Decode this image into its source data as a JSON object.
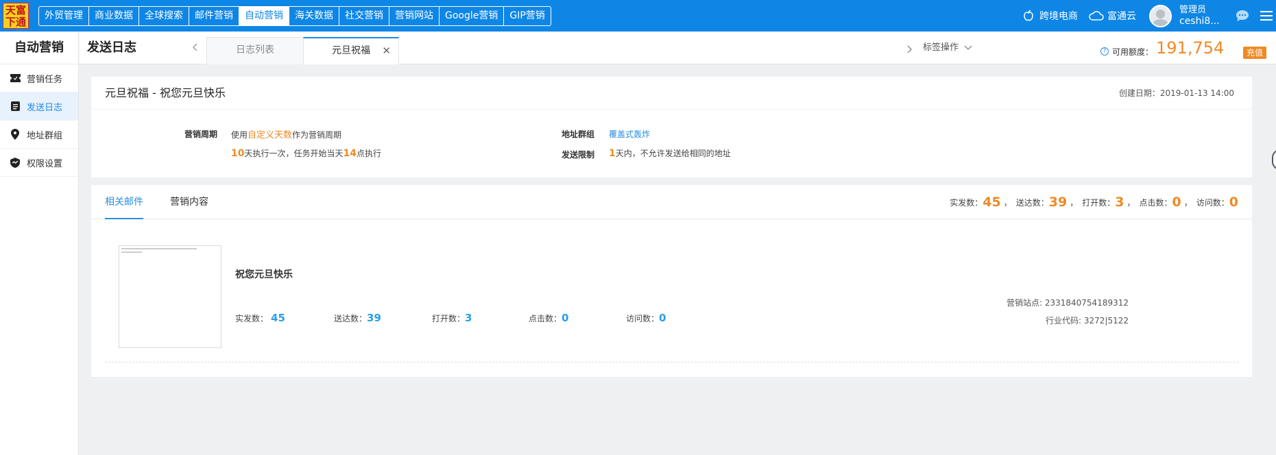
{
  "logo": {
    "text_line1": "天富",
    "text_line2": "下通"
  },
  "nav": {
    "items": [
      "外贸管理",
      "商业数据",
      "全球搜索",
      "邮件营销",
      "自动营销",
      "海关数据",
      "社交营销",
      "营销网站",
      "Google营销",
      "GIP营销"
    ],
    "active": "自动营销"
  },
  "topright": {
    "cross_border": "跨境电商",
    "cloud": "富通云",
    "user_role": "管理员",
    "user_name": "ceshi8..."
  },
  "sidebar": {
    "title": "自动营销",
    "items": [
      {
        "label": "营销任务",
        "icon": "ticket-icon"
      },
      {
        "label": "发送日志",
        "icon": "document-icon",
        "active": true
      },
      {
        "label": "地址群组",
        "icon": "location-pin-icon"
      },
      {
        "label": "权限设置",
        "icon": "shield-icon"
      }
    ]
  },
  "subheader": {
    "page_title": "发送日志",
    "tabs": [
      "日志列表",
      "元旦祝福"
    ],
    "active_tab": "元旦祝福",
    "tag_ops": "标签操作",
    "quota_label": "可用额度：",
    "quota_value": "191,754",
    "recharge": "充值"
  },
  "task": {
    "title": "元旦祝福 - 祝您元旦快乐",
    "created": "创建日期：2019-01-13 14:00",
    "cycle_label": "营销周期",
    "cycle_text_pre": "使用",
    "cycle_highlight": "自定义天数",
    "cycle_text_post": "作为营销周期",
    "cycle_days": "10",
    "cycle_mid": "天执行一次，任务开始当天",
    "cycle_time": "14",
    "cycle_end": "点执行",
    "group_label": "地址群组",
    "group_value": "覆盖式轰炸",
    "limit_label": "发送限制",
    "limit_days": "1",
    "limit_text": "天内，不允许发送给相同的地址"
  },
  "stats_tabs": [
    "相关邮件",
    "营销内容"
  ],
  "summary": {
    "sent_label": "实发数：",
    "sent": "45",
    "delivered_label": "送达数：",
    "delivered": "39",
    "opened_label": "打开数：",
    "opened": "3",
    "clicked_label": "点击数：",
    "clicked": "0",
    "visited_label": "访问数：",
    "visited": "0",
    "sep": "，"
  },
  "email": {
    "subject": "祝您元旦快乐",
    "sent_label": "实发数：",
    "sent": "45",
    "delivered_label": "送达数：",
    "delivered": "39",
    "opened_label": "打开数：",
    "opened": "3",
    "clicked_label": "点击数：",
    "clicked": "0",
    "visited_label": "访问数：",
    "visited": "0",
    "site_label": "营销站点: ",
    "site": "2331840754189312",
    "industry_label": "行业代码: ",
    "industry": "3272|5122"
  },
  "colors": {
    "primary": "#0e86e6",
    "accent": "#f08a24",
    "link": "#2a8ee0"
  }
}
